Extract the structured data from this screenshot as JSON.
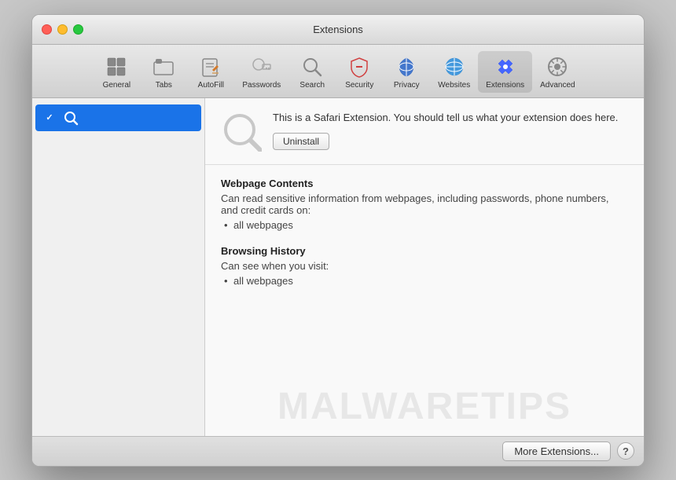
{
  "window": {
    "title": "Extensions"
  },
  "titlebar": {
    "title": "Extensions"
  },
  "toolbar": {
    "items": [
      {
        "id": "general",
        "label": "General",
        "icon": "general-icon"
      },
      {
        "id": "tabs",
        "label": "Tabs",
        "icon": "tabs-icon"
      },
      {
        "id": "autofill",
        "label": "AutoFill",
        "icon": "autofill-icon"
      },
      {
        "id": "passwords",
        "label": "Passwords",
        "icon": "passwords-icon"
      },
      {
        "id": "search",
        "label": "Search",
        "icon": "search-icon"
      },
      {
        "id": "security",
        "label": "Security",
        "icon": "security-icon"
      },
      {
        "id": "privacy",
        "label": "Privacy",
        "icon": "privacy-icon"
      },
      {
        "id": "websites",
        "label": "Websites",
        "icon": "websites-icon"
      },
      {
        "id": "extensions",
        "label": "Extensions",
        "icon": "extensions-icon",
        "active": true
      },
      {
        "id": "advanced",
        "label": "Advanced",
        "icon": "advanced-icon"
      }
    ]
  },
  "sidebar": {
    "items": [
      {
        "id": "search-extension",
        "label": "",
        "checked": true,
        "selected": true
      }
    ]
  },
  "detail": {
    "extension": {
      "description": "This is a Safari Extension. You should tell us what your extension does here.",
      "uninstall_label": "Uninstall"
    },
    "permissions": [
      {
        "title": "Webpage Contents",
        "description": "Can read sensitive information from webpages, including passwords, phone numbers, and credit cards on:",
        "items": [
          "all webpages"
        ]
      },
      {
        "title": "Browsing History",
        "description": "Can see when you visit:",
        "items": [
          "all webpages"
        ]
      }
    ]
  },
  "bottombar": {
    "more_extensions_label": "More Extensions...",
    "help_label": "?"
  },
  "watermark": {
    "text": "MALWARETIPS"
  }
}
